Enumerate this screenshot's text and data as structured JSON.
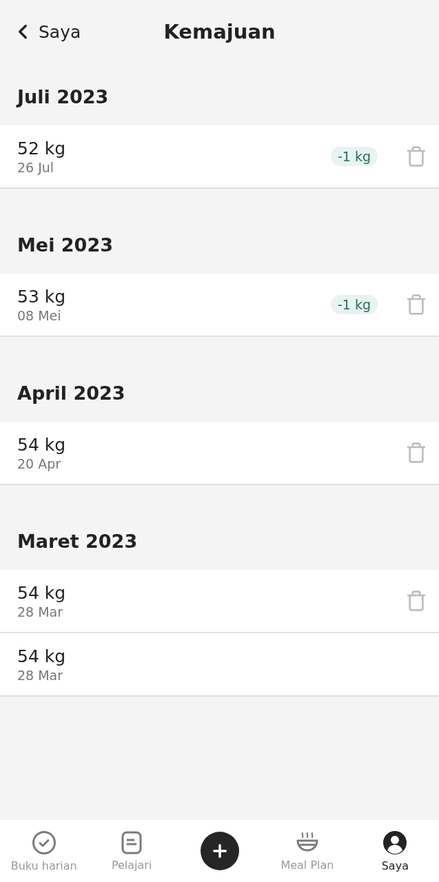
{
  "header": {
    "back_label": "Saya",
    "title": "Kemajuan"
  },
  "sections": [
    {
      "title": "Juli 2023",
      "entries": [
        {
          "weight": "52 kg",
          "date": "26 Jul",
          "change": "-1 kg",
          "deletable": true
        }
      ]
    },
    {
      "title": "Mei 2023",
      "entries": [
        {
          "weight": "53 kg",
          "date": "08 Mei",
          "change": "-1 kg",
          "deletable": true
        }
      ]
    },
    {
      "title": "April 2023",
      "entries": [
        {
          "weight": "54 kg",
          "date": "20 Apr",
          "deletable": true
        }
      ]
    },
    {
      "title": "Maret 2023",
      "entries": [
        {
          "weight": "54 kg",
          "date": "28 Mar",
          "deletable": true
        },
        {
          "weight": "54 kg",
          "date": "28 Mar",
          "deletable": false
        }
      ]
    }
  ],
  "nav": [
    {
      "kind": "diary",
      "label": "Buku harian",
      "selected": false
    },
    {
      "kind": "learn",
      "label": "Pelajari",
      "selected": false
    },
    {
      "kind": "add"
    },
    {
      "kind": "meal",
      "label": "Meal Plan",
      "selected": false
    },
    {
      "kind": "profile",
      "label": "Saya",
      "selected": true
    }
  ]
}
